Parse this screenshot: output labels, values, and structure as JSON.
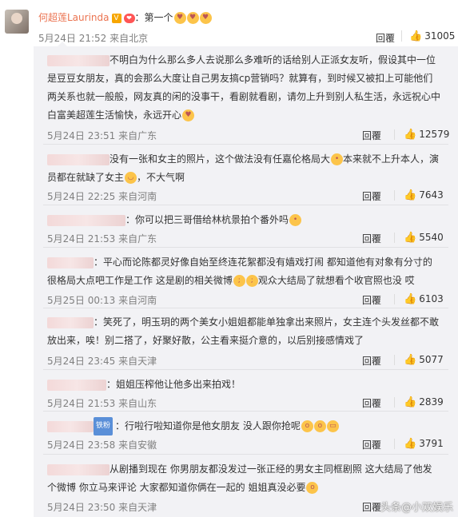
{
  "main_comment": {
    "author": "何超莲Laurinda",
    "verified_badge": "V",
    "vip_badge": "❤",
    "text": "：第一个",
    "emojis": [
      "😍",
      "😍",
      "😍"
    ],
    "time": "5月24日 21:52 来自北京",
    "reply_label": "回覆",
    "likes": "31005"
  },
  "replies": [
    {
      "text": "不明白为什么那么多人去说那么多难听的话给别人正派女友听，假设其中一位是豆豆女朋友，真的会那么大度让自己男友搞cp营销吗？就算有，到时候又被扣上可能他们两关系也就一般般，网友真的闲的没事干，看剧就看剧，请勿上升到别人私生活，永远祝心中白富美超莲生活愉快，永远开心",
      "emoji": "😘",
      "time": "5月24日 23:51 来自广东",
      "reply_label": "回覆",
      "likes": "12579"
    },
    {
      "text": "没有一张和女主的照片，这个做法没有任嘉伦格局大",
      "emoji": "😺",
      "text2": "本来就不上升本人，演员都在就缺了女主",
      "emoji2": "😂",
      "text3": "，不大气啊",
      "time": "5月24日 22:25 来自河南",
      "reply_label": "回覆",
      "likes": "7643"
    },
    {
      "text": "你可以把三哥借给林杭景拍个番外吗",
      "emoji": "😺",
      "time": "5月24日 21:53 来自广东",
      "reply_label": "回覆",
      "likes": "5540"
    },
    {
      "text": "平心而论陈都灵好像自始至终连花絮都没有嫱戏打闹 都知道他有对象有分寸的很格局大点吧工作是工作 这是剧的相关微博",
      "emoji": "😭😭",
      "text2": "观众大结局了就想看个收官照也没 哎",
      "time": "5月25日 00:13 来自河南",
      "reply_label": "回覆",
      "likes": "6103"
    },
    {
      "text": "笑死了，明玉玥的两个美女小姐姐都能单独拿出来照片，女主连个头发丝都不敢放出来，唉！别二搭了，好聚好散，公主看来挺介意的，以后别接感情戏了",
      "time": "5月24日 23:45 来自天津",
      "reply_label": "回覆",
      "likes": "5077"
    },
    {
      "text": "姐姐压榨他让他多出来拍戏！",
      "time": "5月24日 21:53 来自山东",
      "reply_label": "回覆",
      "likes": "2839"
    },
    {
      "badge": "铁粉",
      "text": "：行啦行啦知道你是他女朋友 没人跟你抢呢",
      "emoji": "😱😱😷",
      "time": "5月24日 23:58 来自安徽",
      "reply_label": "回覆",
      "likes": "3791"
    },
    {
      "text": "从剧播到现在 你男朋友都没发过一张正经的男女主同框剧照 这大结局了他发个微博 你立马来评论 大家都知道你俩在一起的 姐姐真没必要",
      "emoji": "😱",
      "time": "5月24日 23:50 来自天津",
      "reply_label": "回覆",
      "likes": ""
    }
  ],
  "watermark": "头条@小双娱乐"
}
